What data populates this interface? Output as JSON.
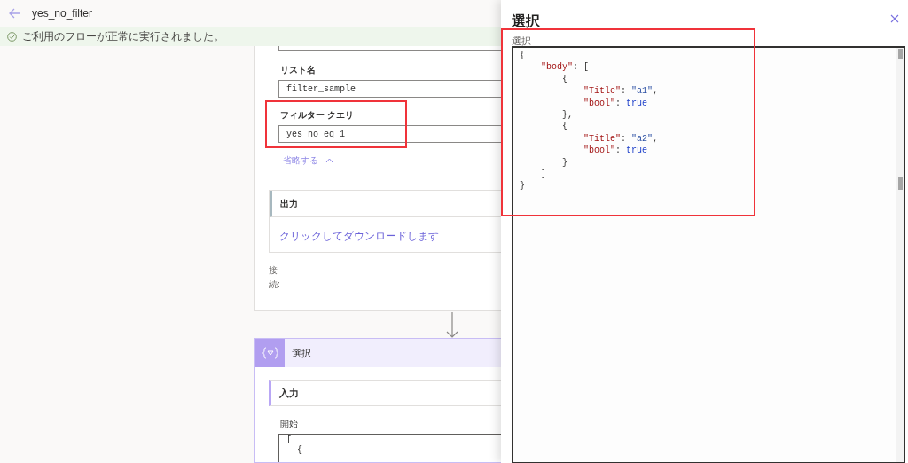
{
  "header": {
    "title": "yes_no_filter"
  },
  "banner": {
    "message": "ご利用のフローが正常に実行されました。"
  },
  "action_card": {
    "fields": [
      {
        "label": "リスト名",
        "value": "filter_sample",
        "highlighted": false
      },
      {
        "label": "フィルター クエリ",
        "value": "yes_no eq 1",
        "highlighted": true
      }
    ],
    "collapse_link": "省略する",
    "output": {
      "title": "出力",
      "link": "クリックしてダウンロードします"
    },
    "connection_label": "接続:"
  },
  "select_card": {
    "title": "選択",
    "input": {
      "title": "入力",
      "field_label": "開始",
      "code_lines": [
        "[",
        "  {"
      ]
    }
  },
  "panel": {
    "title": "選択",
    "field_label": "選択",
    "highlighted": true,
    "code_lines": [
      [
        {
          "kind": "punct",
          "text": "{"
        }
      ],
      [
        {
          "kind": "key",
          "text": "    \"body\""
        },
        {
          "kind": "punct",
          "text": ": ["
        }
      ],
      [
        {
          "kind": "punct",
          "text": "        {"
        }
      ],
      [
        {
          "kind": "key",
          "text": "            \"Title\""
        },
        {
          "kind": "punct",
          "text": ": "
        },
        {
          "kind": "string",
          "text": "\"a1\""
        },
        {
          "kind": "punct",
          "text": ","
        }
      ],
      [
        {
          "kind": "key",
          "text": "            \"bool\""
        },
        {
          "kind": "punct",
          "text": ": "
        },
        {
          "kind": "keyword",
          "text": "true"
        }
      ],
      [
        {
          "kind": "punct",
          "text": "        },"
        }
      ],
      [
        {
          "kind": "punct",
          "text": "        {"
        }
      ],
      [
        {
          "kind": "key",
          "text": "            \"Title\""
        },
        {
          "kind": "punct",
          "text": ": "
        },
        {
          "kind": "string",
          "text": "\"a2\""
        },
        {
          "kind": "punct",
          "text": ","
        }
      ],
      [
        {
          "kind": "key",
          "text": "            \"bool\""
        },
        {
          "kind": "punct",
          "text": ": "
        },
        {
          "kind": "keyword",
          "text": "true"
        }
      ],
      [
        {
          "kind": "punct",
          "text": "        }"
        }
      ],
      [
        {
          "kind": "punct",
          "text": "    ]"
        }
      ],
      [
        {
          "kind": "punct",
          "text": "}"
        }
      ]
    ]
  }
}
